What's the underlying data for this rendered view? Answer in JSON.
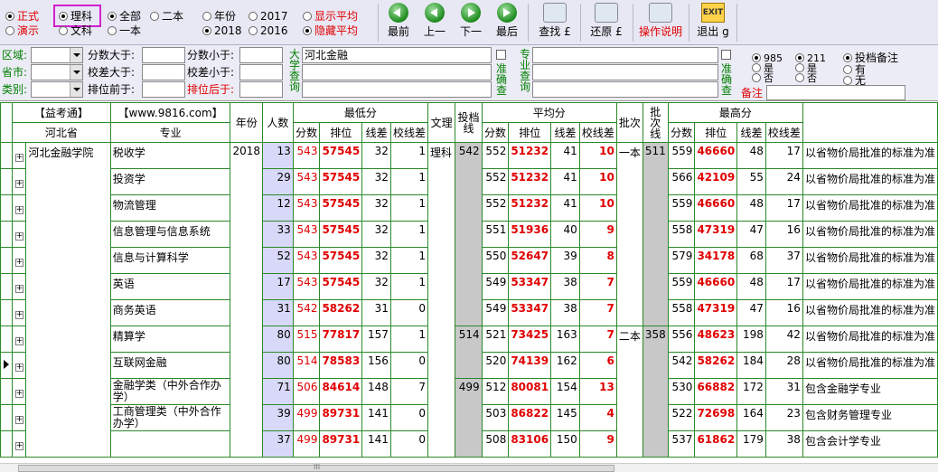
{
  "toolbar": {
    "mode": [
      {
        "label": "正式",
        "on": true
      },
      {
        "label": "演示",
        "on": false
      }
    ],
    "subject": [
      {
        "label": "理科",
        "on": true
      },
      {
        "label": "文科",
        "on": false
      }
    ],
    "batch": [
      {
        "label": "全部",
        "on": true
      },
      {
        "label": "二本",
        "on": false
      },
      {
        "label": "一本",
        "on": false
      }
    ],
    "year": [
      {
        "label": "年份",
        "on": false
      },
      {
        "label": "2017",
        "on": false
      },
      {
        "label": "2018",
        "on": true
      },
      {
        "label": "2016",
        "on": false
      }
    ],
    "avg": [
      {
        "label": "显示平均",
        "on": false
      },
      {
        "label": "隐藏平均",
        "on": true
      }
    ],
    "buttons": {
      "first": "最前",
      "prev": "上一",
      "next": "下一",
      "last": "最后",
      "find": "查找 £",
      "restore": "还原 £",
      "help": "操作说明",
      "exit": "退出 g",
      "exit_icon_text": "EXIT"
    }
  },
  "filters": {
    "region_label": "区域:",
    "province_label": "省市:",
    "category_label": "类别:",
    "score_gt_label": "分数大于:",
    "diff_gt_label": "校差大于:",
    "rank_before_label": "排位前于:",
    "score_lt_label": "分数小于:",
    "diff_lt_label": "校差小于:",
    "rank_after_label": "排位后于:",
    "university_query_label": "大学查询",
    "university_query_value": "河北金融",
    "exact_label_1": "准确查",
    "major_query_label": "专业查询",
    "exact_label_2": "准确查",
    "r985": [
      {
        "label": "985",
        "on": true
      },
      {
        "label": "是",
        "on": false
      },
      {
        "label": "否",
        "on": false
      }
    ],
    "r211": [
      {
        "label": "211",
        "on": true
      },
      {
        "label": "是",
        "on": false
      },
      {
        "label": "否",
        "on": false
      }
    ],
    "rnote": [
      {
        "label": "投档备注",
        "on": true
      },
      {
        "label": "有",
        "on": false
      },
      {
        "label": "无",
        "on": false
      }
    ],
    "remark_label": "备注"
  },
  "grid": {
    "group_header_1": "【益考通】",
    "group_header_2": "【www.9816.com】",
    "province_header": "河北省",
    "major_header": "专业",
    "year_header": "年份",
    "count_header": "人数",
    "min_header": "最低分",
    "wl_header": "文理",
    "toudang_header": "投档线",
    "avg_header": "平均分",
    "pici_header": "批次",
    "pcx_header": "批次线",
    "max_header": "最高分",
    "sub_fen": "分数",
    "sub_rank": "排位",
    "sub_xc": "线差",
    "sub_xxc": "校线差",
    "school": "河北金融学院",
    "rows": [
      {
        "major": "税收学",
        "year": "2018",
        "count": "13",
        "min": "543",
        "minr": "57545",
        "minxc": "32",
        "minxx": "1",
        "wl": "理科",
        "td": "542",
        "avg": "552",
        "avgr": "51232",
        "avgxc": "41",
        "avgxx": "10",
        "pici": "一本",
        "pcx": "511",
        "max": "559",
        "maxr": "46660",
        "maxxc": "48",
        "maxxx": "17",
        "note": "以省物价局批准的标准为准"
      },
      {
        "major": "投资学",
        "year": "",
        "count": "29",
        "min": "543",
        "minr": "57545",
        "minxc": "32",
        "minxx": "1",
        "wl": "",
        "td": "",
        "avg": "552",
        "avgr": "51232",
        "avgxc": "41",
        "avgxx": "10",
        "pici": "",
        "pcx": "",
        "max": "566",
        "maxr": "42109",
        "maxxc": "55",
        "maxxx": "24",
        "note": "以省物价局批准的标准为准"
      },
      {
        "major": "物流管理",
        "year": "",
        "count": "12",
        "min": "543",
        "minr": "57545",
        "minxc": "32",
        "minxx": "1",
        "wl": "",
        "td": "",
        "avg": "552",
        "avgr": "51232",
        "avgxc": "41",
        "avgxx": "10",
        "pici": "",
        "pcx": "",
        "max": "559",
        "maxr": "46660",
        "maxxc": "48",
        "maxxx": "17",
        "note": "以省物价局批准的标准为准"
      },
      {
        "major": "信息管理与信息系统",
        "year": "",
        "count": "33",
        "min": "543",
        "minr": "57545",
        "minxc": "32",
        "minxx": "1",
        "wl": "",
        "td": "",
        "avg": "551",
        "avgr": "51936",
        "avgxc": "40",
        "avgxx": "9",
        "pici": "",
        "pcx": "",
        "max": "558",
        "maxr": "47319",
        "maxxc": "47",
        "maxxx": "16",
        "note": "以省物价局批准的标准为准"
      },
      {
        "major": "信息与计算科学",
        "year": "",
        "count": "52",
        "min": "543",
        "minr": "57545",
        "minxc": "32",
        "minxx": "1",
        "wl": "",
        "td": "",
        "avg": "550",
        "avgr": "52647",
        "avgxc": "39",
        "avgxx": "8",
        "pici": "",
        "pcx": "",
        "max": "579",
        "maxr": "34178",
        "maxxc": "68",
        "maxxx": "37",
        "note": "以省物价局批准的标准为准"
      },
      {
        "major": "英语",
        "year": "",
        "count": "17",
        "min": "543",
        "minr": "57545",
        "minxc": "32",
        "minxx": "1",
        "wl": "",
        "td": "",
        "avg": "549",
        "avgr": "53347",
        "avgxc": "38",
        "avgxx": "7",
        "pici": "",
        "pcx": "",
        "max": "559",
        "maxr": "46660",
        "maxxc": "48",
        "maxxx": "17",
        "note": "以省物价局批准的标准为准"
      },
      {
        "major": "商务英语",
        "year": "",
        "count": "31",
        "min": "542",
        "minr": "58262",
        "minxc": "31",
        "minxx": "0",
        "wl": "",
        "td": "",
        "avg": "549",
        "avgr": "53347",
        "avgxc": "38",
        "avgxx": "7",
        "pici": "",
        "pcx": "",
        "max": "558",
        "maxr": "47319",
        "maxxc": "47",
        "maxxx": "16",
        "note": "以省物价局批准的标准为准"
      },
      {
        "major": "精算学",
        "year": "",
        "count": "80",
        "min": "515",
        "minr": "77817",
        "minxc": "157",
        "minxx": "1",
        "wl": "",
        "td": "514",
        "avg": "521",
        "avgr": "73425",
        "avgxc": "163",
        "avgxx": "7",
        "pici": "二本",
        "pcx": "358",
        "max": "556",
        "maxr": "48623",
        "maxxc": "198",
        "maxxx": "42",
        "note": "以省物价局批准的标准为准"
      },
      {
        "major": "互联网金融",
        "year": "",
        "count": "80",
        "min": "514",
        "minr": "78583",
        "minxc": "156",
        "minxx": "0",
        "wl": "",
        "td": "",
        "avg": "520",
        "avgr": "74139",
        "avgxc": "162",
        "avgxx": "6",
        "pici": "",
        "pcx": "",
        "max": "542",
        "maxr": "58262",
        "maxxc": "184",
        "maxxx": "28",
        "note": "以省物价局批准的标准为准"
      },
      {
        "major": "金融学类（中外合作办学）",
        "year": "",
        "count": "71",
        "min": "506",
        "minr": "84614",
        "minxc": "148",
        "minxx": "7",
        "wl": "",
        "td": "499",
        "avg": "512",
        "avgr": "80081",
        "avgxc": "154",
        "avgxx": "13",
        "pici": "",
        "pcx": "",
        "max": "530",
        "maxr": "66882",
        "maxxc": "172",
        "maxxx": "31",
        "note": "包含金融学专业"
      },
      {
        "major": "工商管理类（中外合作办学）",
        "year": "",
        "count": "39",
        "min": "499",
        "minr": "89731",
        "minxc": "141",
        "minxx": "0",
        "wl": "",
        "td": "",
        "avg": "503",
        "avgr": "86822",
        "avgxc": "145",
        "avgxx": "4",
        "pici": "",
        "pcx": "",
        "max": "522",
        "maxr": "72698",
        "maxxc": "164",
        "maxxx": "23",
        "note": "包含财务管理专业"
      },
      {
        "major": "",
        "year": "",
        "count": "37",
        "min": "499",
        "minr": "89731",
        "minxc": "141",
        "minxx": "0",
        "wl": "",
        "td": "",
        "avg": "508",
        "avgr": "83106",
        "avgxc": "150",
        "avgxx": "9",
        "pici": "",
        "pcx": "",
        "max": "537",
        "maxr": "61862",
        "maxxc": "179",
        "maxxx": "38",
        "note": "包含会计学专业"
      }
    ],
    "current_row": 8
  },
  "scroll_mark": "III"
}
